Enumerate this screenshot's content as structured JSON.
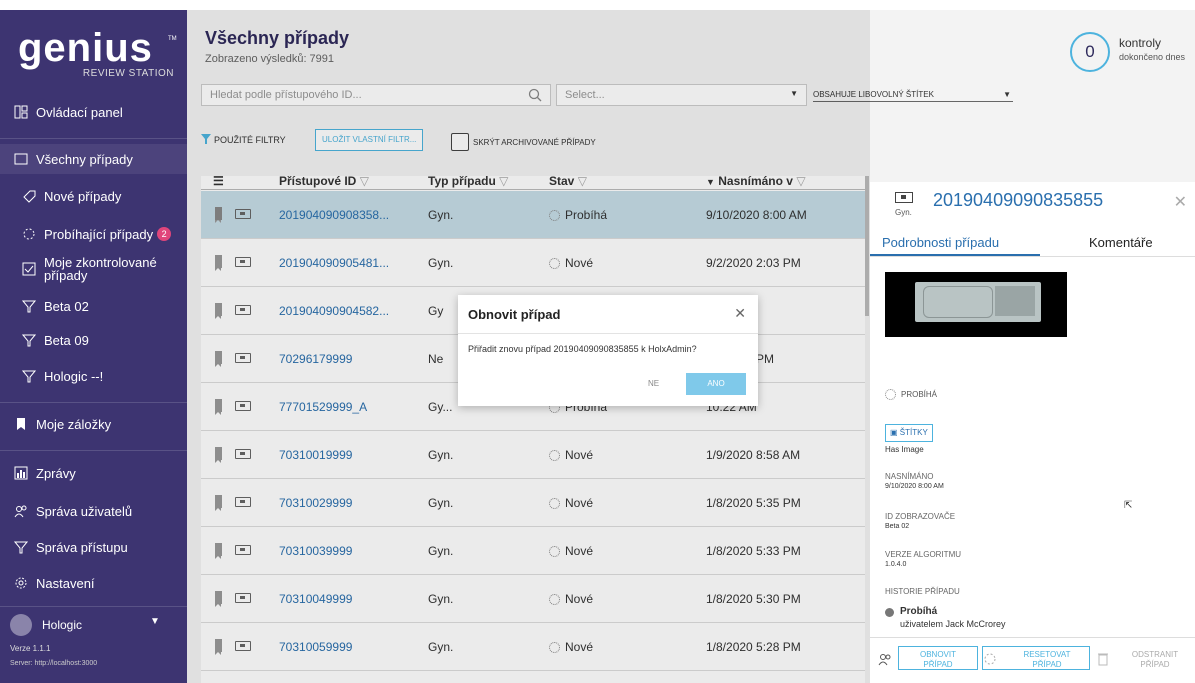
{
  "sidebar": {
    "logo": "genius",
    "logo_tm": "TM",
    "logo_sub": "REVIEW STATION",
    "items": [
      {
        "label": "Ovládací panel"
      },
      {
        "label": "Všechny případy"
      },
      {
        "label": "Nové případy"
      },
      {
        "label": "Probíhající případy",
        "badge": "2"
      },
      {
        "label": "Moje zkontrolované případy"
      },
      {
        "label": "Beta 02"
      },
      {
        "label": "Beta 09"
      },
      {
        "label": "Hologic --!"
      },
      {
        "label": "Moje záložky"
      },
      {
        "label": "Zprávy"
      },
      {
        "label": "Správa uživatelů"
      },
      {
        "label": "Správa přístupu"
      },
      {
        "label": "Nastavení"
      }
    ],
    "user": "Hologic",
    "version": "Verze 1.1.1",
    "server": "Server: http://localhost:3000"
  },
  "header": {
    "title": "Všechny případy",
    "result_count": "Zobrazeno výsledků: 7991",
    "checks_count": "0",
    "checks_line1": "kontroly",
    "checks_line2": "dokončeno dnes"
  },
  "filters": {
    "search_placeholder": "Hledat podle přístupového ID...",
    "select_placeholder": "Select...",
    "tag_filter": "OBSAHUJE LIBOVOLNÝ ŠTÍTEK",
    "applied": "POUŽITÉ FILTRY",
    "save_custom": "ULOŽIT VLASTNÍ FILTR...",
    "hide_archived": "SKRÝT ARCHIVOVANÉ PŘÍPADY"
  },
  "table": {
    "headers": {
      "id": "Přístupové ID",
      "type": "Typ případu",
      "status": "Stav",
      "scanned": "Nasnímáno v"
    },
    "rows": [
      {
        "id": "201904090908358...",
        "type": "Gyn.",
        "status": "Probíhá",
        "date": "9/10/2020 8:00 AM"
      },
      {
        "id": "201904090905481...",
        "type": "Gyn.",
        "status": "Nové",
        "date": "9/2/2020 2:03 PM"
      },
      {
        "id": "201904090904582...",
        "type": "Gy",
        "status": "",
        "date": ") 2:03 PM"
      },
      {
        "id": "70296179999",
        "type": "Ne",
        "status": "",
        "date": "20 12:04 PM"
      },
      {
        "id": "77701529999_A",
        "type": "Gy...",
        "status": "Probíhá",
        "date": "10:22 AM"
      },
      {
        "id": "70310019999",
        "type": "Gyn.",
        "status": "Nové",
        "date": "1/9/2020 8:58 AM"
      },
      {
        "id": "70310029999",
        "type": "Gyn.",
        "status": "Nové",
        "date": "1/8/2020 5:35 PM"
      },
      {
        "id": "70310039999",
        "type": "Gyn.",
        "status": "Nové",
        "date": "1/8/2020 5:33 PM"
      },
      {
        "id": "70310049999",
        "type": "Gyn.",
        "status": "Nové",
        "date": "1/8/2020 5:30 PM"
      },
      {
        "id": "70310059999",
        "type": "Gyn.",
        "status": "Nové",
        "date": "1/8/2020 5:28 PM"
      }
    ]
  },
  "dialog": {
    "title": "Obnovit případ",
    "body": "Přiřadit znovu případ 20190409090835855 k HolxAdmin?",
    "no": "NE",
    "yes": "ANO"
  },
  "panel": {
    "case_id": "20190409090835855",
    "type": "Gyn.",
    "tab_details": "Podrobnosti případu",
    "tab_comments": "Komentáře",
    "status": "PROBÍHÁ",
    "tags_button": "ŠTÍTKY",
    "has_image": "Has Image",
    "scanned_label": "NASNÍMÁNO",
    "scanned_value": "9/10/2020 8:00 AM",
    "imager_label": "ID ZOBRAZOVAČE",
    "imager_value": "Beta 02",
    "algo_label": "VERZE ALGORITMU",
    "algo_value": "1.0.4.0",
    "history_label": "HISTORIE PŘÍPADU",
    "history_status": "Probíhá",
    "history_by": "uživatelem Jack McCrorey",
    "btn_reopen_1": "OBNOVIT",
    "btn_reopen_2": "PŘÍPAD",
    "btn_reset_1": "RESETOVAT",
    "btn_reset_2": "PŘÍPAD",
    "btn_remove_1": "ODSTRANIT",
    "btn_remove_2": "PŘÍPAD"
  }
}
